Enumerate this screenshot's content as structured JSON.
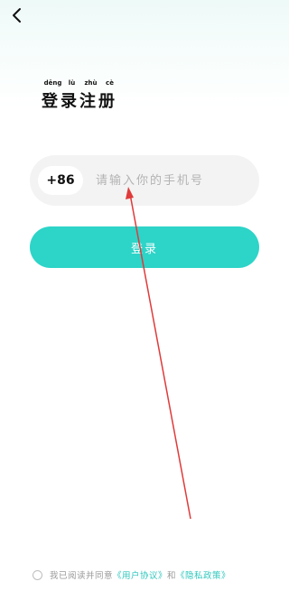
{
  "header": {
    "back_icon": "chevron-left-icon"
  },
  "title": {
    "pinyin": [
      "dēng",
      "lù",
      "zhù",
      "cè"
    ],
    "text": "登录注册"
  },
  "phone": {
    "country_code": "+86",
    "placeholder": "请输入你的手机号",
    "value": ""
  },
  "login_button": {
    "label": "登录"
  },
  "agreement": {
    "prefix": "我已阅读并同意",
    "user_agreement": "《用户协议》",
    "conjunction": "和",
    "privacy_policy": "《隐私政策》"
  },
  "colors": {
    "accent": "#2dd4c8",
    "link": "#2dc6bc",
    "annotation_arrow": "#e03a3a"
  }
}
